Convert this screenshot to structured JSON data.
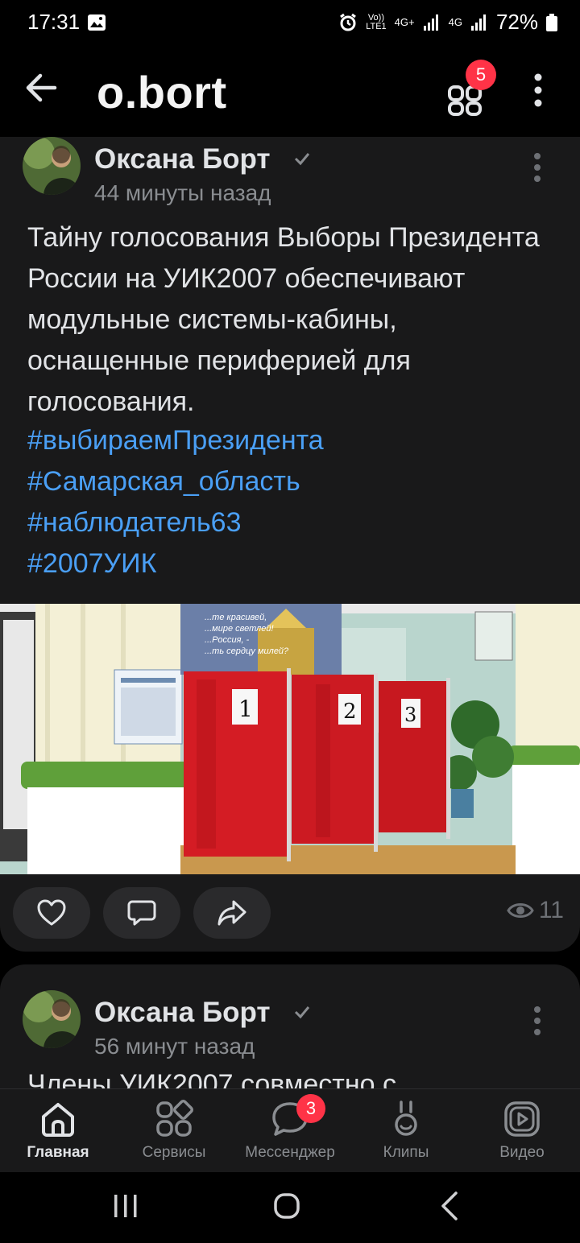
{
  "status_bar": {
    "time": "17:31",
    "volte_top": "Vo))",
    "volte_bottom": "LTE1",
    "net1": "4G+",
    "net2": "4G",
    "battery": "72%"
  },
  "header": {
    "title": "o.bort",
    "services_badge": "5"
  },
  "post": {
    "author": "Оксана Борт",
    "time": "44 минуты назад",
    "text": "Тайну голосования Выборы Президента России на УИК2007 обеспечивают модульные системы-кабины, оснащенные периферией для голосования.",
    "hashtags": [
      "#выбираемПрезидента",
      "#Самарская_область",
      "#наблюдатель63",
      "#2007УИК"
    ],
    "photo": {
      "banner_lines": [
        "...те красивей,",
        "...мире светлей!",
        "...Россия, -",
        "...ть сердцу милей?"
      ],
      "booth_numbers": [
        "1",
        "2",
        "3"
      ]
    },
    "views": "11"
  },
  "post2": {
    "author": "Оксана Борт",
    "time": "56 минут назад",
    "text_partial": "Члены УИК2007 совместно с"
  },
  "bottom_nav": {
    "items": [
      {
        "label": "Главная",
        "active": true
      },
      {
        "label": "Сервисы"
      },
      {
        "label": "Мессенджер",
        "badge": "3"
      },
      {
        "label": "Клипы"
      },
      {
        "label": "Видео"
      }
    ]
  },
  "colors": {
    "background": "#000000",
    "card": "#19191a",
    "hashtag": "#4a9ff5",
    "badge": "#ff3347",
    "muted": "#8a8d91"
  }
}
